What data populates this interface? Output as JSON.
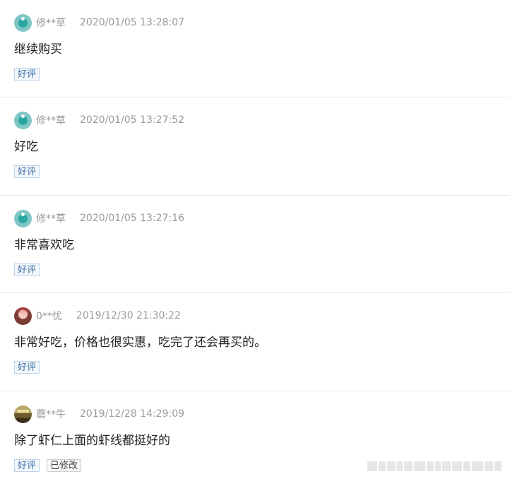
{
  "reviews": [
    {
      "avatar_icon": "teal-default-avatar-icon",
      "username": "修**草",
      "time": "2020/01/05 13:28:07",
      "content": "继续购买",
      "tags": [
        "好评"
      ]
    },
    {
      "avatar_icon": "teal-default-avatar-icon",
      "username": "修**草",
      "time": "2020/01/05 13:27:52",
      "content": "好吃",
      "tags": [
        "好评"
      ]
    },
    {
      "avatar_icon": "teal-default-avatar-icon",
      "username": "修**草",
      "time": "2020/01/05 13:27:16",
      "content": "非常喜欢吃",
      "tags": [
        "好评"
      ]
    },
    {
      "avatar_icon": "user-photo-avatar-icon",
      "username": "0**忧",
      "time": "2019/12/30 21:30:22",
      "content": "非常好吃，价格也很实惠，吃完了还会再买的。",
      "tags": [
        "好评"
      ]
    },
    {
      "avatar_icon": "user-photo-avatar-icon",
      "username": "蘑**牛",
      "time": "2019/12/28 14:29:09",
      "content": "除了虾仁上面的虾线都挺好的",
      "tags": [
        "好评",
        "已修改"
      ]
    }
  ],
  "colors": {
    "username": "#999999",
    "timestamp": "#9a9a9a",
    "tag_border": "#bcd2ea",
    "tag_text": "#3d6fa3",
    "divider": "#e8e8e8"
  }
}
